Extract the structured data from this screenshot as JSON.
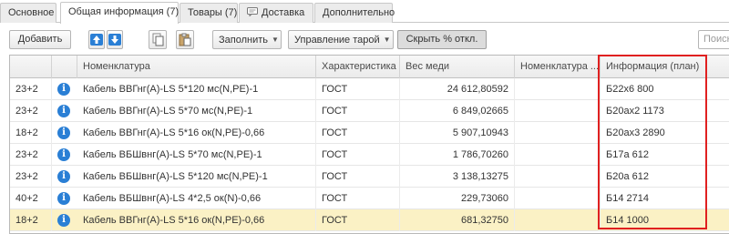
{
  "tabs": [
    {
      "label": "Основное"
    },
    {
      "label": "Общая информация (7)",
      "active": true
    },
    {
      "label": "Товары (7)"
    },
    {
      "label": "Доставка",
      "icon": "chat-bubble-icon"
    },
    {
      "label": "Дополнительно"
    }
  ],
  "toolbar": {
    "add_label": "Добавить",
    "move_up_icon": "arrow-up-icon",
    "move_down_icon": "arrow-down-icon",
    "copy_icon": "copy-icon",
    "paste_icon": "paste-icon",
    "fill_label": "Заполнить",
    "tare_label": "Управление тарой",
    "hide_pct_label": "Скрыть % откл.",
    "search_placeholder": "Поиск"
  },
  "table": {
    "headers": [
      "Номенклатура",
      "Характеристика",
      "Вес меди",
      "Номенклатура ...",
      "Информация (план)"
    ],
    "rows": [
      {
        "code": "23+2",
        "name": "Кабель ВВГнг(А)-LS 5*120 мс(N,PE)-1",
        "char": "ГОСТ",
        "weight": "24 612,80592",
        "nom2": "",
        "info": "Б22х6 800"
      },
      {
        "code": "23+2",
        "name": "Кабель ВВГнг(А)-LS 5*70 мс(N,PE)-1",
        "char": "ГОСТ",
        "weight": "6 849,02665",
        "nom2": "",
        "info": "Б20ах2 1173"
      },
      {
        "code": "18+2",
        "name": "Кабель ВВГнг(А)-LS 5*16 ок(N,PE)-0,66",
        "char": "ГОСТ",
        "weight": "5 907,10943",
        "nom2": "",
        "info": "Б20ах3 2890"
      },
      {
        "code": "23+2",
        "name": "Кабель ВБШвнг(А)-LS 5*70 мс(N,PE)-1",
        "char": "ГОСТ",
        "weight": "1 786,70260",
        "nom2": "",
        "info": "Б17а 612"
      },
      {
        "code": "23+2",
        "name": "Кабель ВБШвнг(А)-LS 5*120 мс(N,PE)-1",
        "char": "ГОСТ",
        "weight": "3 138,13275",
        "nom2": "",
        "info": "Б20а 612"
      },
      {
        "code": "40+2",
        "name": "Кабель ВБШвнг(А)-LS 4*2,5 ок(N)-0,66",
        "char": "ГОСТ",
        "weight": "229,73060",
        "nom2": "",
        "info": "Б14 2714"
      },
      {
        "code": "18+2",
        "name": "Кабель ВВГнг(А)-LS 5*16 ок(N,PE)-0,66",
        "char": "ГОСТ",
        "weight": "681,32750",
        "nom2": "",
        "info": "Б14 1000",
        "selected": true
      }
    ],
    "info_icon_glyph": "i"
  },
  "colors": {
    "accent_blue": "#2a7fd5",
    "selected_row": "#fbf1c5",
    "highlight_border": "#e02020"
  }
}
